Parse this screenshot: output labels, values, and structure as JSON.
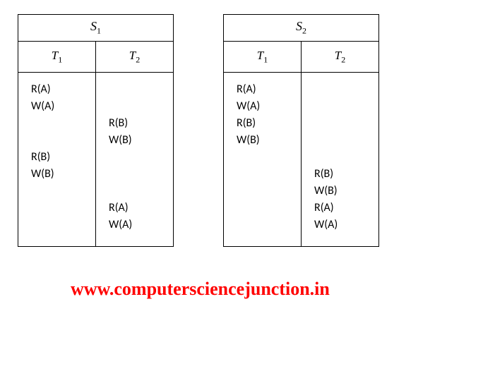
{
  "schedule1": {
    "label": "S",
    "sub": "1",
    "headers": {
      "t1": {
        "label": "T",
        "sub": "1"
      },
      "t2": {
        "label": "T",
        "sub": "2"
      }
    },
    "col1": {
      "r1": "R(A)",
      "r2": "W(A)",
      "r3": "R(B)",
      "r4": "W(B)"
    },
    "col2": {
      "r1": "R(B)",
      "r2": "W(B)",
      "r3": "R(A)",
      "r4": "W(A)"
    }
  },
  "schedule2": {
    "label": "S",
    "sub": "2",
    "headers": {
      "t1": {
        "label": "T",
        "sub": "1"
      },
      "t2": {
        "label": "T",
        "sub": "2"
      }
    },
    "col1": {
      "r1": "R(A)",
      "r2": "W(A)",
      "r3": "R(B)",
      "r4": "W(B)"
    },
    "col2": {
      "r1": "R(B)",
      "r2": "W(B)",
      "r3": "R(A)",
      "r4": "W(A)"
    }
  },
  "watermark": "www.computersciencejunction.in"
}
